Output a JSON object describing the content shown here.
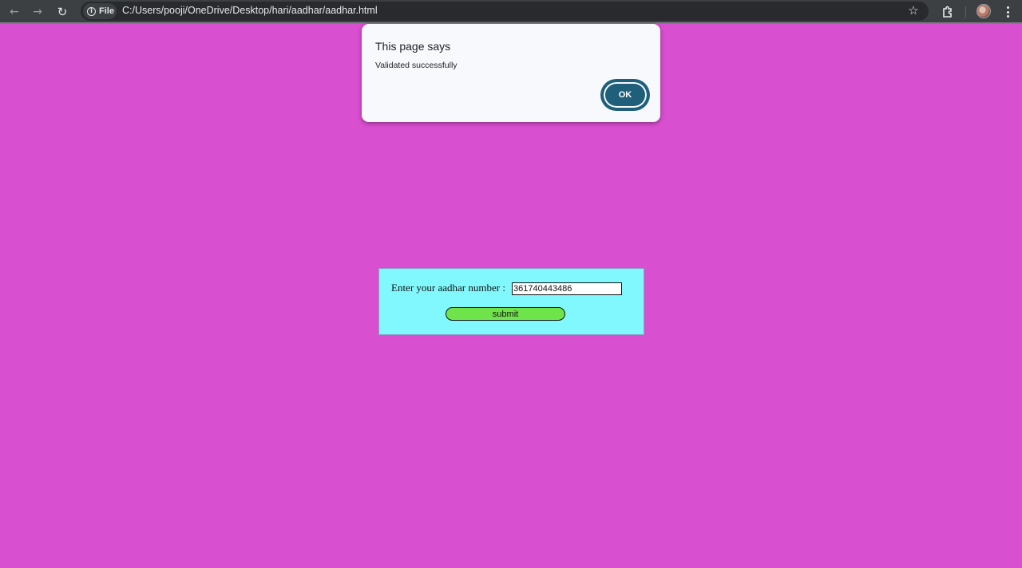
{
  "browser": {
    "chip_label": "File",
    "url": "C:/Users/pooji/OneDrive/Desktop/hari/aadhar/aadhar.html",
    "icons": [
      "back-icon",
      "forward-icon",
      "reload-icon",
      "info-icon",
      "star-icon",
      "extensions-icon",
      "avatar",
      "menu-icon"
    ]
  },
  "alert": {
    "title": "This page says",
    "message": "Validated successfully",
    "ok_label": "OK"
  },
  "form": {
    "label": "Enter your aadhar number :",
    "input_value": "361740443486",
    "submit_label": "submit"
  },
  "colors": {
    "page_background": "#d84fd0",
    "form_background": "#80f8fd",
    "submit_background": "#6ee34a",
    "ok_button": "#1f5f7a"
  }
}
